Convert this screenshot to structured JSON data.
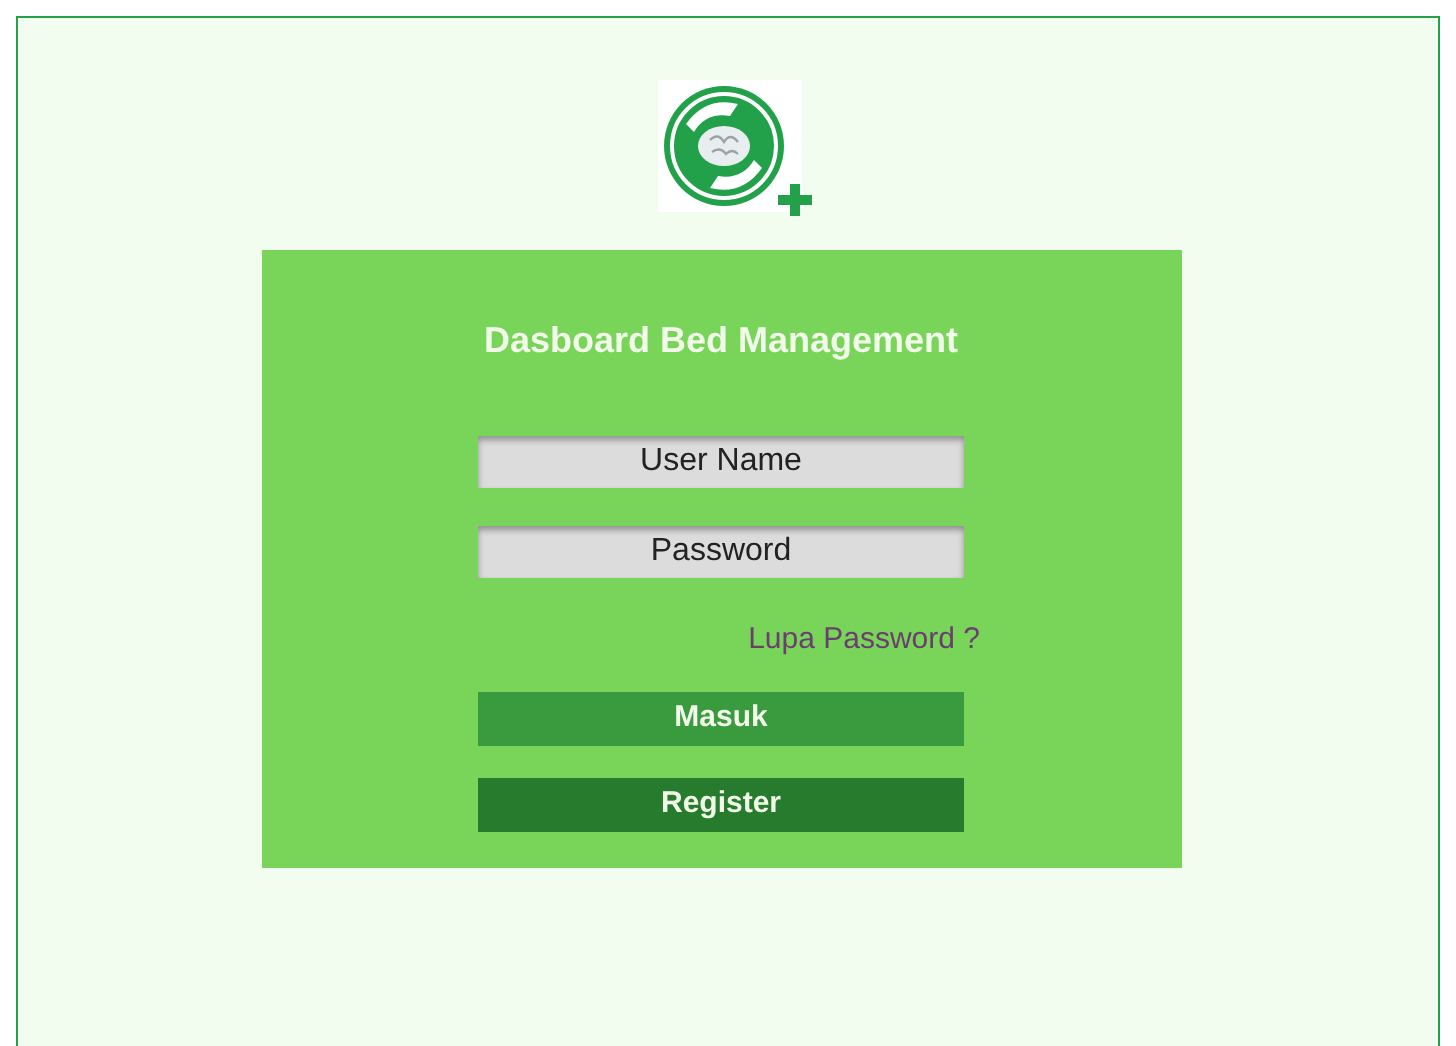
{
  "title": "Dasboard Bed Management",
  "fields": [
    {
      "placeholder": "User Name"
    },
    {
      "placeholder": "Password"
    }
  ],
  "forgot_link": "Lupa Password ?",
  "buttons": [
    {
      "label": "Masuk",
      "kind": "primary"
    },
    {
      "label": "Register",
      "kind": "secondary"
    }
  ]
}
